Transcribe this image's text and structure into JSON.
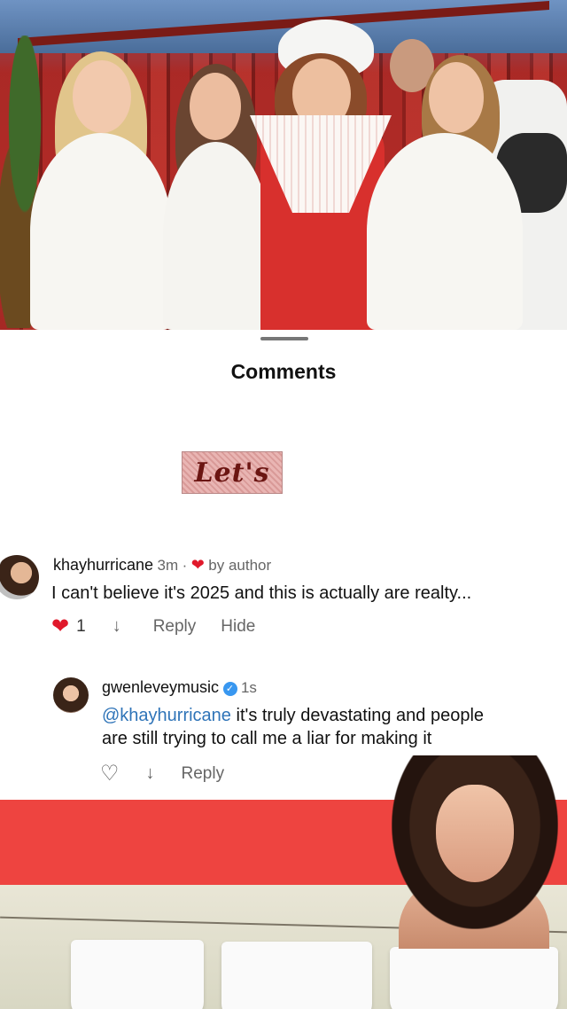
{
  "sheet": {
    "title": "Comments"
  },
  "sticker": {
    "text": "Let's"
  },
  "comments": [
    {
      "username": "khayhurricane",
      "time": "3m",
      "separator": "·",
      "author_badge": "by author",
      "text": "I can't believe it's 2025 and this is actually are realty...",
      "like_count": "1",
      "reply_label": "Reply",
      "hide_label": "Hide"
    },
    {
      "username": "gwenleveymusic",
      "time": "1s",
      "mention": "@khayhurricane",
      "text_line1": " it's truly devastating and people",
      "text_line2": "are still trying to call me a liar for making it",
      "reply_label": "Reply"
    }
  ],
  "colors": {
    "heart": "#e0192b",
    "mention": "#2f74b8",
    "verified": "#3897f0",
    "banner_red": "#ee4440"
  },
  "icons": [
    "heart-filled-icon",
    "heart-outline-icon",
    "dislike-arrow-icon",
    "verified-badge-icon"
  ]
}
